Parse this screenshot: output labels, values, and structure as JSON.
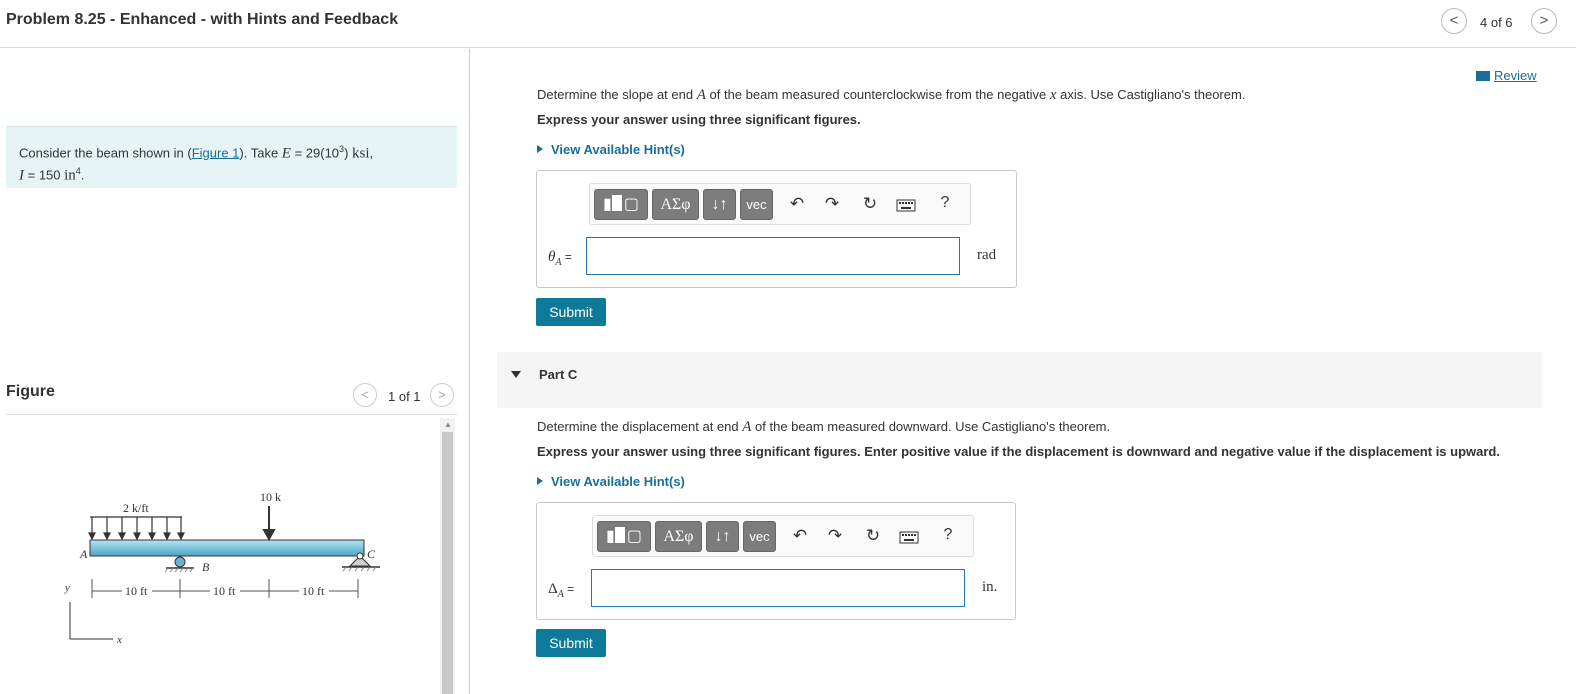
{
  "header": {
    "title": "Problem 8.25 - Enhanced - with Hints and Feedback",
    "counter": "4 of 6",
    "prev": "<",
    "next": ">"
  },
  "intro": {
    "text_pre": "Consider the beam shown in (",
    "link": "Figure 1",
    "text_mid": "). Take ",
    "E_sym": "E",
    "E_val": " = 29(10",
    "E_exp": "3",
    "E_close": ") ",
    "E_unit": "ksi",
    "comma": ",",
    "I_sym": "I",
    "I_val": " = 150 ",
    "I_unit": "in",
    "I_exp": "4",
    "period": "."
  },
  "figure_panel": {
    "label": "Figure",
    "counter": "1 of 1",
    "prev": "<",
    "next": ">",
    "drawing": {
      "load_dist": "2 k/ft",
      "load_point": "10 k",
      "point_A": "A",
      "point_B": "B",
      "point_C": "C",
      "dim1": "10 ft",
      "dim2": "10 ft",
      "dim3": "10 ft",
      "axis_y": "y",
      "axis_x": "x"
    }
  },
  "review": {
    "label": "Review"
  },
  "partB": {
    "question_pre": "Determine the slope at end ",
    "point": "A",
    "question_mid": " of the beam measured counterclockwise from the negative ",
    "axis": "x",
    "question_post": " axis. Use Castigliano's theorem.",
    "instruction": "Express your answer using three significant figures.",
    "hint": "View Available Hint(s)",
    "symbol_main": "θ",
    "symbol_sub": "A",
    "equals": " =",
    "input_value": "",
    "unit": "rad",
    "submit": "Submit"
  },
  "partC": {
    "label": "Part C",
    "question_pre": "Determine the displacement at end ",
    "point": "A",
    "question_post": " of the beam measured downward. Use Castigliano's theorem.",
    "instruction": "Express your answer using three significant figures. Enter positive value if the displacement is downward and negative value if the displacement is upward.",
    "hint": "View Available Hint(s)",
    "symbol_main": "Δ",
    "symbol_sub": "A",
    "equals": " =",
    "input_value": "",
    "unit": "in.",
    "submit": "Submit"
  },
  "toolbar": {
    "templates_icon": "templates-icon",
    "greek": "ΑΣφ",
    "updown": "↓↑",
    "vec": "vec",
    "undo": "↶",
    "redo": "↷",
    "reset": "↻",
    "keyboard_icon": "keyboard-icon",
    "help": "?"
  },
  "colors": {
    "accent": "#0d7a99",
    "link": "#1a6e9a",
    "intro_bg": "#e6f4f5",
    "beam": "#7cc6de",
    "toolbar_btn": "#7c7c7c"
  }
}
